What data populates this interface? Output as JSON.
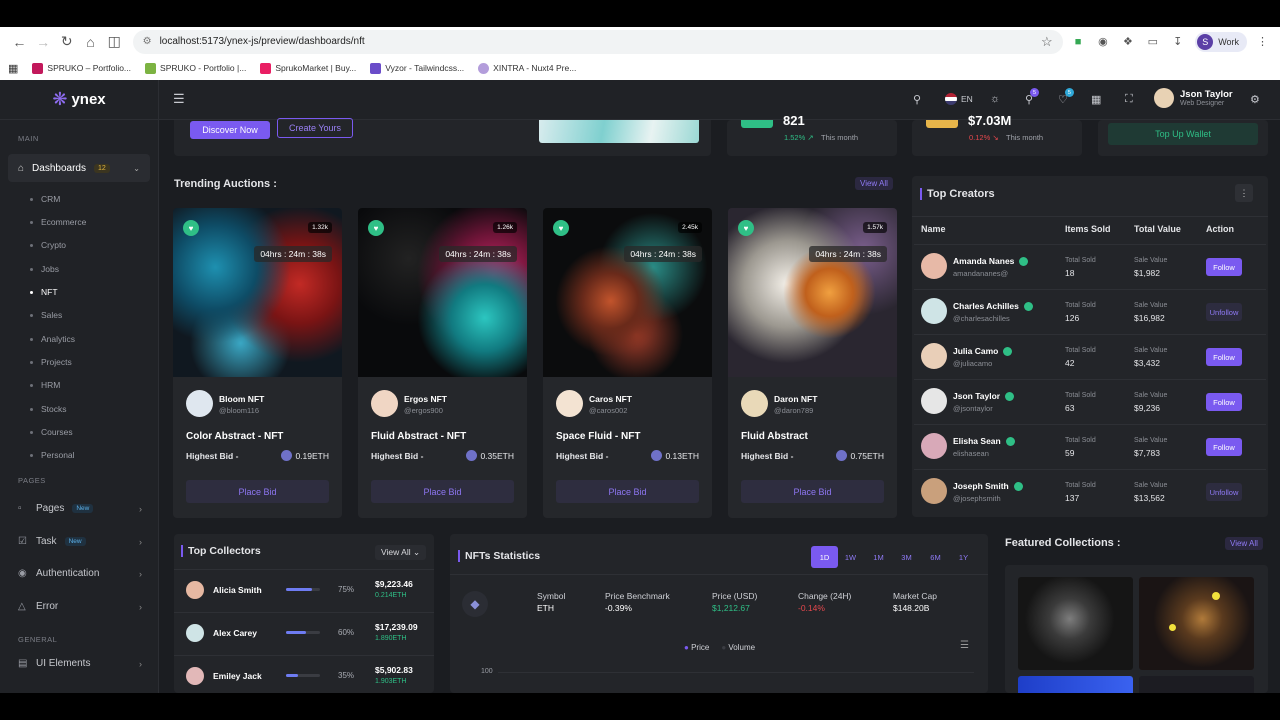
{
  "browser": {
    "url": "localhost:5173/ynex-js/preview/dashboards/nft",
    "profile_initial": "S",
    "profile_label": "Work",
    "bookmarks": [
      "SPRUKO – Portfolio...",
      "SPRUKO - Portfolio |...",
      "SprukoMarket | Buy...",
      "Vyzor - Tailwindcss...",
      "XINTRA - Nuxt4 Pre..."
    ]
  },
  "sidebar": {
    "logo": "ynex",
    "main_label": "MAIN",
    "dashboards_label": "Dashboards",
    "dashboards_count": "12",
    "sub_items": [
      "CRM",
      "Ecommerce",
      "Crypto",
      "Jobs",
      "NFT",
      "Sales",
      "Analytics",
      "Projects",
      "HRM",
      "Stocks",
      "Courses",
      "Personal"
    ],
    "pages_label": "PAGES",
    "pages": "Pages",
    "task": "Task",
    "new_badge": "New",
    "authentication": "Authentication",
    "error": "Error",
    "general_label": "GENERAL",
    "ui_elements": "UI Elements"
  },
  "header": {
    "lang": "EN",
    "cart_count": "5",
    "notif_count": "5",
    "user_name": "Json Taylor",
    "user_role": "Web Designer"
  },
  "top": {
    "discover": "Discover Now",
    "create": "Create Yours",
    "stat1_value": "821",
    "stat1_change": "1.52%",
    "stat1_period": "This month",
    "stat2_value": "$7.03M",
    "stat2_change": "0.12%",
    "stat2_period": "This month",
    "topup": "Top Up Wallet"
  },
  "trending": {
    "title": "Trending Auctions :",
    "view_all": "View All",
    "items": [
      {
        "likes": "1.32k",
        "timer": "04hrs : 24m : 38s",
        "name": "Bloom NFT",
        "handle": "@bloom116",
        "title": "Color Abstract - NFT",
        "bid_label": "Highest Bid -",
        "eth": "0.19ETH",
        "place": "Place Bid"
      },
      {
        "likes": "1.26k",
        "timer": "04hrs : 24m : 38s",
        "name": "Ergos NFT",
        "handle": "@ergos900",
        "title": "Fluid Abstract - NFT",
        "bid_label": "Highest Bid -",
        "eth": "0.35ETH",
        "place": "Place Bid"
      },
      {
        "likes": "2.45k",
        "timer": "04hrs : 24m : 38s",
        "name": "Caros NFT",
        "handle": "@caros002",
        "title": "Space Fluid - NFT",
        "bid_label": "Highest Bid -",
        "eth": "0.13ETH",
        "place": "Place Bid"
      },
      {
        "likes": "1.57k",
        "timer": "04hrs : 24m : 38s",
        "name": "Daron NFT",
        "handle": "@daron789",
        "title": "Fluid Abstract",
        "bid_label": "Highest Bid -",
        "eth": "0.75ETH",
        "place": "Place Bid"
      }
    ]
  },
  "creators": {
    "title": "Top Creators",
    "columns": [
      "Name",
      "Items Sold",
      "Total Value",
      "Action"
    ],
    "items_label": "Total Sold",
    "value_label": "Sale Value",
    "rows": [
      {
        "name": "Amanda Nanes",
        "handle": "amandananes@",
        "sold": "18",
        "value": "$1,982",
        "action": "Follow"
      },
      {
        "name": "Charles Achilles",
        "handle": "@charlesachilles",
        "sold": "126",
        "value": "$16,982",
        "action": "Unfollow"
      },
      {
        "name": "Julia Camo",
        "handle": "@juliacamo",
        "sold": "42",
        "value": "$3,432",
        "action": "Follow"
      },
      {
        "name": "Json Taylor",
        "handle": "@jsontaylor",
        "sold": "63",
        "value": "$9,236",
        "action": "Follow"
      },
      {
        "name": "Elisha Sean",
        "handle": "elishasean",
        "sold": "59",
        "value": "$7,783",
        "action": "Follow"
      },
      {
        "name": "Joseph Smith",
        "handle": "@josephsmith",
        "sold": "137",
        "value": "$13,562",
        "action": "Unfollow"
      }
    ]
  },
  "collectors": {
    "title": "Top Collectors",
    "view_all": "View All",
    "rows": [
      {
        "name": "Alicia Smith",
        "pct": "75%",
        "fill": 0.75,
        "amount": "$9,223.46",
        "eth": "0.214ETH"
      },
      {
        "name": "Alex Carey",
        "pct": "60%",
        "fill": 0.6,
        "amount": "$17,239.09",
        "eth": "1.890ETH"
      },
      {
        "name": "Emiley Jack",
        "pct": "35%",
        "fill": 0.35,
        "amount": "$5,902.83",
        "eth": "1.903ETH"
      }
    ]
  },
  "stats": {
    "title": "NFTs Statistics",
    "tabs": [
      "1D",
      "1W",
      "1M",
      "3M",
      "6M",
      "1Y"
    ],
    "symbol_label": "Symbol",
    "symbol": "ETH",
    "bench_label": "Price Benchmark",
    "bench": "-0.39%",
    "price_label": "Price (USD)",
    "price": "$1,212.67",
    "change_label": "Change (24H)",
    "change": "-0.14%",
    "cap_label": "Market Cap",
    "cap": "$148.20B",
    "legend_price": "Price",
    "legend_volume": "Volume",
    "y_tick": "100"
  },
  "featured": {
    "title": "Featured Collections :",
    "view_all": "View All"
  }
}
